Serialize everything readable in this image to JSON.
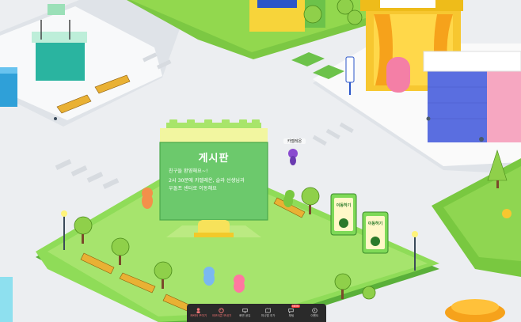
{
  "board": {
    "title": "게시판",
    "line1": "친구들 환영해요~!",
    "line2": "2시 30분에 카멜레온, 슬라 선생님과",
    "line3": "우돌프 센터로 이동해요"
  },
  "avatar": {
    "name": "카멜레온"
  },
  "signs": {
    "left": "이동하기",
    "right": "이동하기"
  },
  "toolbar": {
    "items": [
      {
        "label": "캐릭터 꾸미기",
        "icon": "character-icon"
      },
      {
        "label": "이모티콘 보내기",
        "icon": "emoji-icon"
      },
      {
        "label": "화면 공유",
        "icon": "screen-share-icon"
      },
      {
        "label": "미니맵 추가",
        "icon": "map-icon"
      },
      {
        "label": "채팅",
        "icon": "chat-icon",
        "badge": "NEW"
      },
      {
        "label": "이벤트",
        "icon": "event-icon"
      }
    ]
  },
  "colors": {
    "grass": "#7ed957",
    "platform": "#9ae04f",
    "board": "#67c96b",
    "road": "#f1f3f5",
    "toolbar": "#2a2a2a"
  }
}
